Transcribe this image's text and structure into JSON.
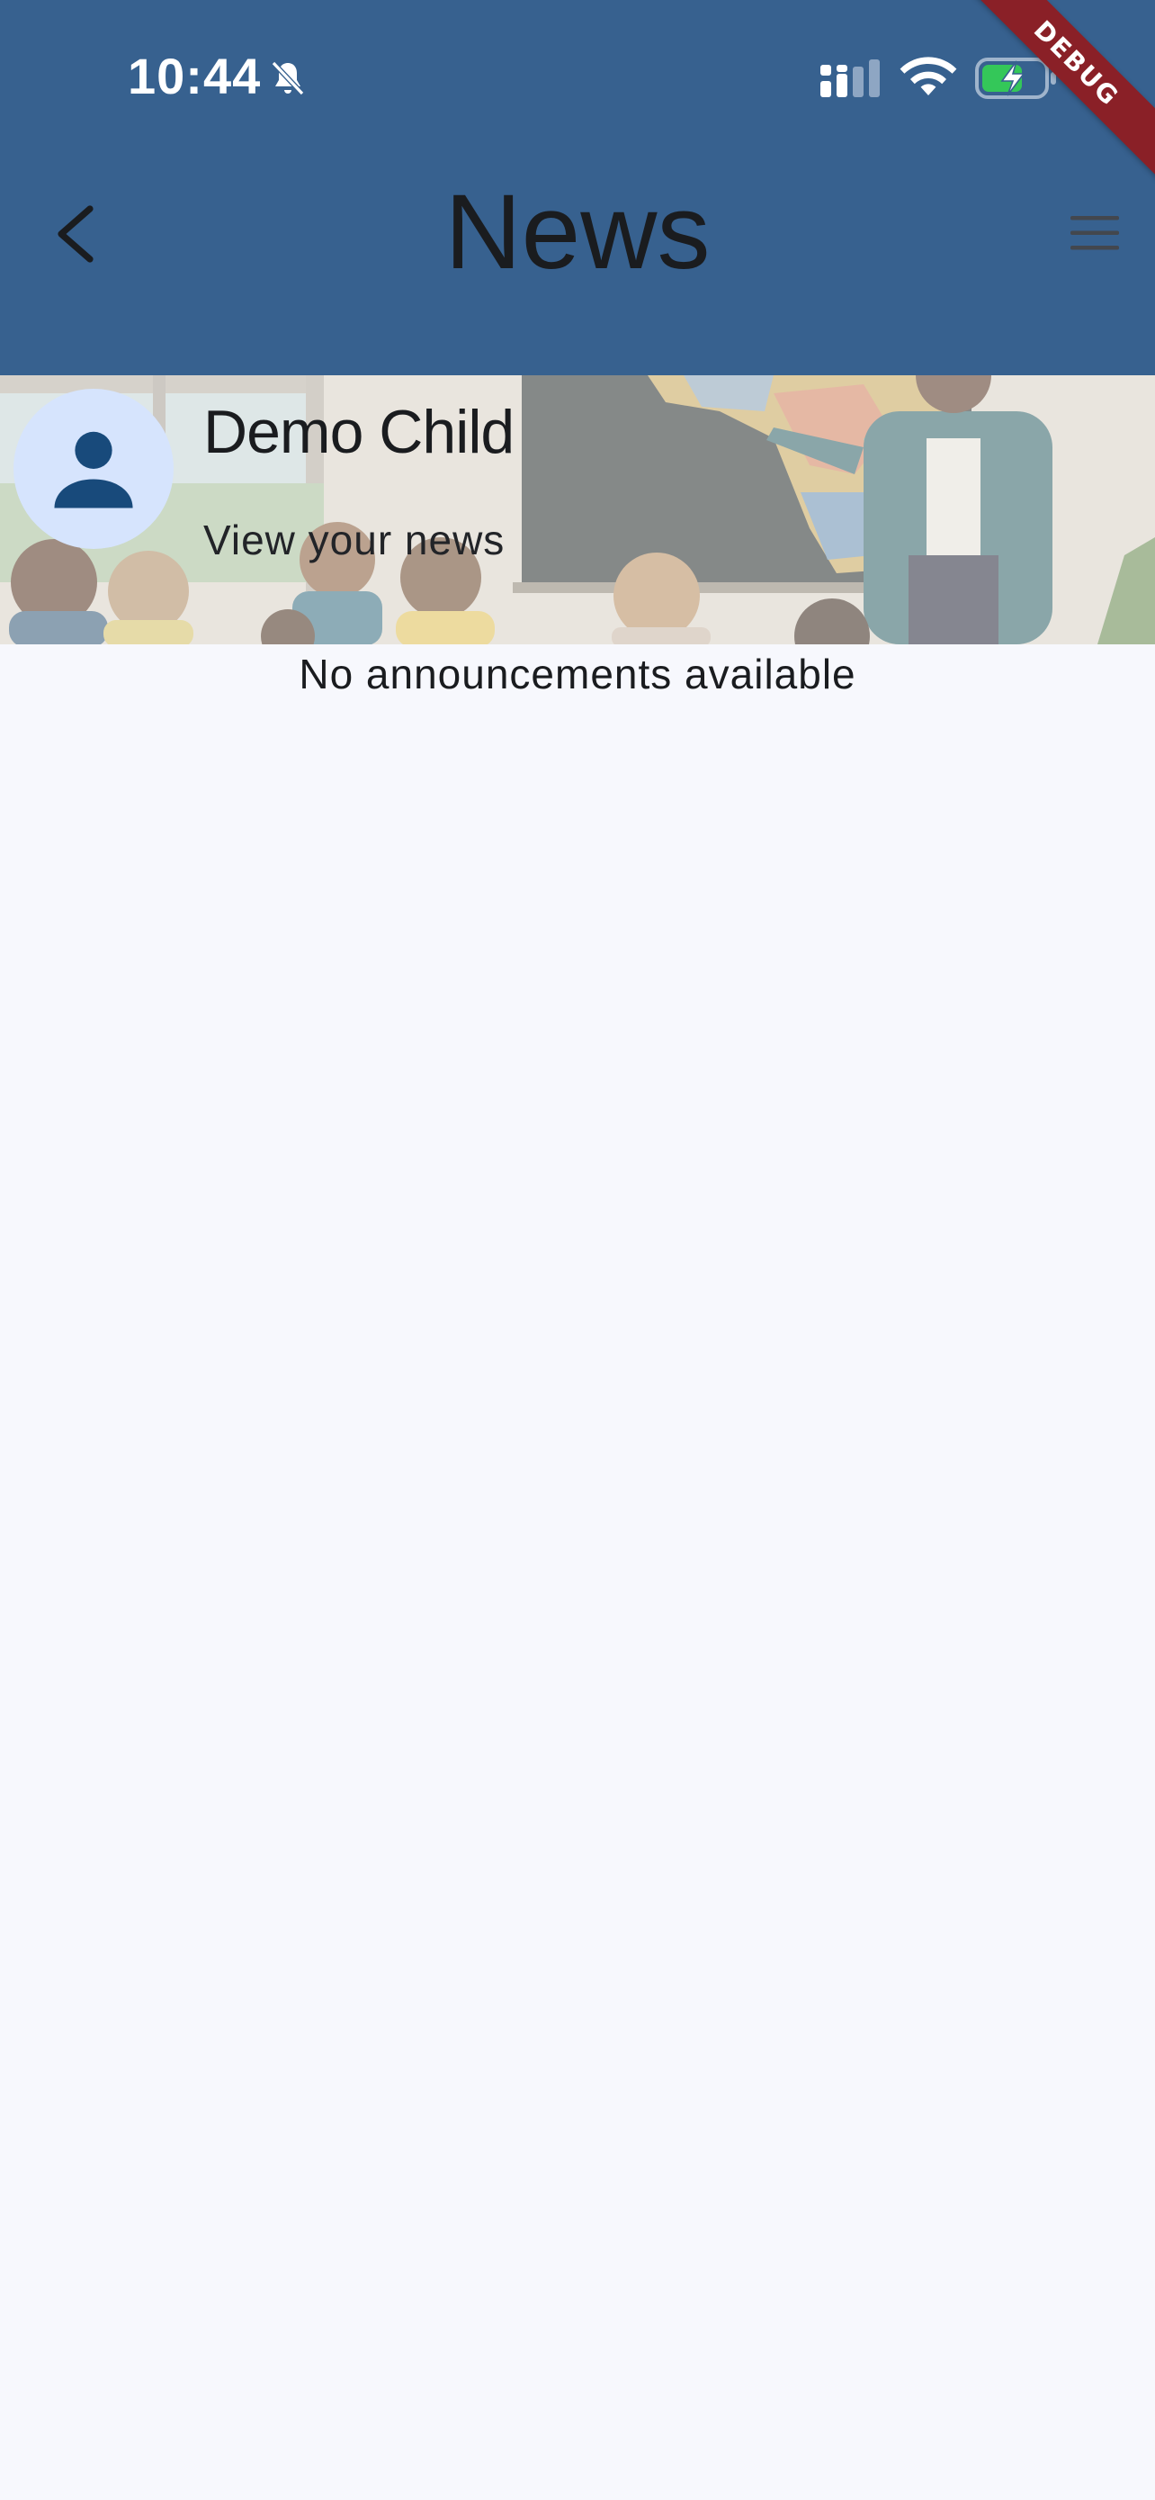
{
  "status_bar": {
    "time": "10:44",
    "icons": [
      "bell-muted-icon",
      "cellular-signal-icon",
      "wifi-icon",
      "battery-charging-icon"
    ]
  },
  "debug_banner": "DEBUG",
  "app_bar": {
    "title": "News",
    "back_icon": "chevron-left-icon",
    "menu_icon": "hamburger-menu-icon"
  },
  "header": {
    "name": "Demo Child",
    "subtitle": "View your news",
    "avatar_icon": "person-icon"
  },
  "content": {
    "empty_message": "No announcements available"
  },
  "colors": {
    "app_bar": "#37618f",
    "background": "#f7f8fd",
    "avatar_bg": "#d6e4fd",
    "avatar_icon": "#184a7b",
    "debug_ribbon": "#8a2027",
    "battery_fill": "#34c759"
  }
}
